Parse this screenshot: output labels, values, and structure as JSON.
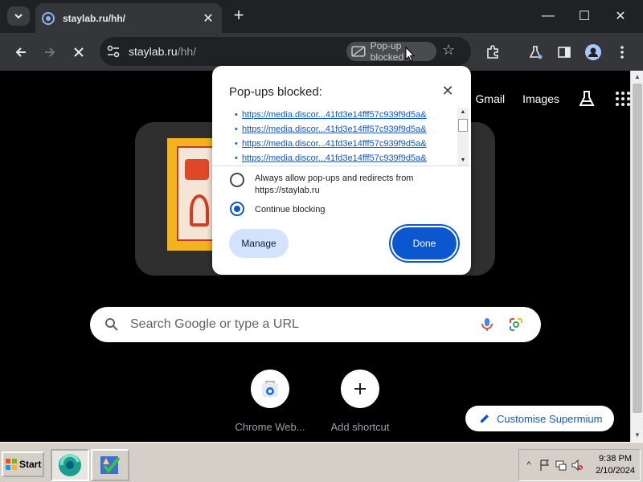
{
  "tab": {
    "title": "staylab.ru/hh/"
  },
  "window_controls": {
    "minimize": "—",
    "maximize": "☐",
    "close": "✕"
  },
  "toolbar": {
    "url_host": "staylab.ru",
    "url_path": "/hh/",
    "popup_chip_label": "Pop-up blocked"
  },
  "page": {
    "top_links": {
      "gmail": "Gmail",
      "images": "Images"
    },
    "search": {
      "placeholder": "Search Google or type a URL"
    },
    "shortcuts": [
      {
        "label": "Chrome Web..."
      },
      {
        "label": "Add shortcut"
      }
    ],
    "customise_label": "Customise Supermium"
  },
  "dialog": {
    "title": "Pop-ups blocked:",
    "links": [
      "https://media.discor...41fd3e14fff57c939f9d5a&",
      "https://media.discor...41fd3e14fff57c939f9d5a&",
      "https://media.discor...41fd3e14fff57c939f9d5a&",
      "https://media.discor...41fd3e14fff57c939f9d5a&"
    ],
    "option_allow": "Always allow pop-ups and redirects from https://staylab.ru",
    "option_block": "Continue blocking",
    "selected_option": "Continue blocking",
    "manage_label": "Manage",
    "done_label": "Done"
  },
  "taskbar": {
    "start_label": "Start",
    "time": "9:38 PM",
    "date": "2/10/2024"
  },
  "colors": {
    "accent_blue": "#0b57d0",
    "chrome_dark": "#35363a",
    "tabstrip": "#202124",
    "page_bg": "#000000"
  }
}
